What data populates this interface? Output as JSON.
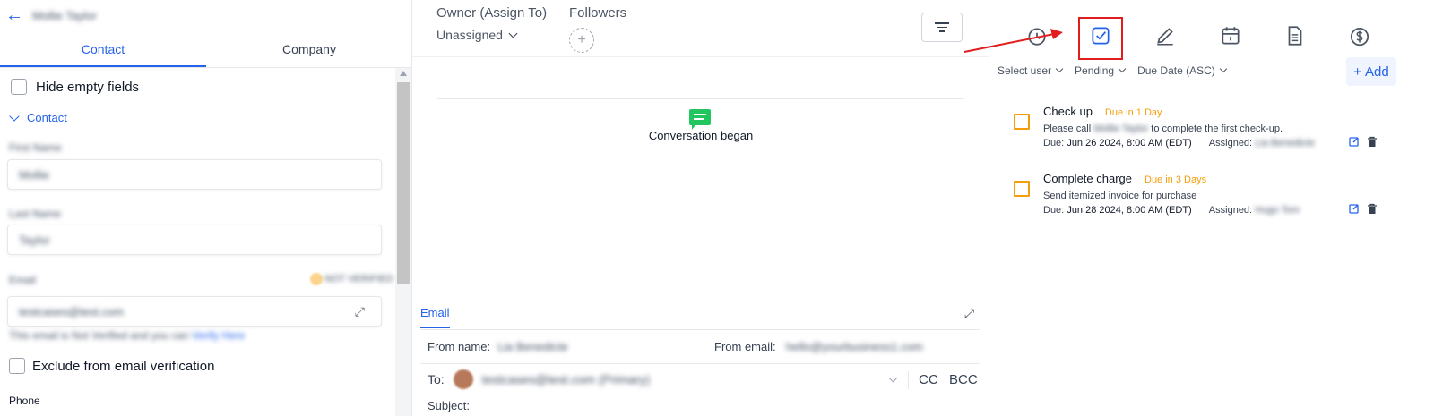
{
  "left_panel": {
    "back_icon": "arrow-left-icon",
    "contact_name": "Mollie Taylor",
    "tabs": [
      {
        "label": "Contact",
        "active": true
      },
      {
        "label": "Company",
        "active": false
      }
    ],
    "hide_empty_label": "Hide empty fields",
    "section_contact": "Contact",
    "first_name": {
      "label": "First Name",
      "value": "Mollie"
    },
    "last_name": {
      "label": "Last Name",
      "value": "Taylor"
    },
    "email": {
      "label": "Email",
      "badge": "NOT VERIFIED",
      "value": "testcases@test.com",
      "note": "This email is Not Verified and you can",
      "note_link": "Verify Here"
    },
    "exclude_label": "Exclude from email verification",
    "phone_label": "Phone"
  },
  "middle_panel": {
    "owner_label": "Owner (Assign To)",
    "owner_value": "Unassigned",
    "followers_label": "Followers",
    "conversation_text": "Conversation began",
    "compose": {
      "tab": "Email",
      "from_name_label": "From name:",
      "from_name_value": "Lia Benedicte",
      "from_email_label": "From email:",
      "from_email_value": "hello@yourbusiness1.com",
      "to_label": "To:",
      "to_value": "testcases@test.com (Primary)",
      "cc": "CC",
      "bcc": "BCC",
      "subject_label": "Subject:"
    }
  },
  "right_panel": {
    "tabs": [
      {
        "icon": "clock-icon",
        "active": false
      },
      {
        "icon": "task-checkbox-icon",
        "active": true
      },
      {
        "icon": "pencil-icon",
        "active": false
      },
      {
        "icon": "calendar-icon",
        "active": false
      },
      {
        "icon": "document-icon",
        "active": false
      },
      {
        "icon": "dollar-icon",
        "active": false
      }
    ],
    "filters": {
      "user": "Select user",
      "status": "Pending",
      "sort": "Due Date (ASC)"
    },
    "add_label": "Add",
    "tasks": [
      {
        "title": "Check up",
        "due_badge": "Due in 1 Day",
        "description_prefix": "Please call",
        "description_blurred": "Mollie Taylor",
        "description_suffix": "to complete the first check-up.",
        "due_label": "Due:",
        "due_date": "Jun 26 2024, 8:00 AM (EDT)",
        "assigned_label": "Assigned:",
        "assigned_to": "Lia Benedicte"
      },
      {
        "title": "Complete charge",
        "due_badge": "Due in 3 Days",
        "description": "Send itemized invoice for purchase",
        "due_label": "Due:",
        "due_date": "Jun 28 2024, 8:00 AM (EDT)",
        "assigned_label": "Assigned:",
        "assigned_to": "Hugo Tom"
      }
    ]
  },
  "colors": {
    "accent": "#2563eb",
    "warning": "#f59e0b",
    "annotation": "#e11d1d",
    "conversation_icon": "#22c55e"
  }
}
